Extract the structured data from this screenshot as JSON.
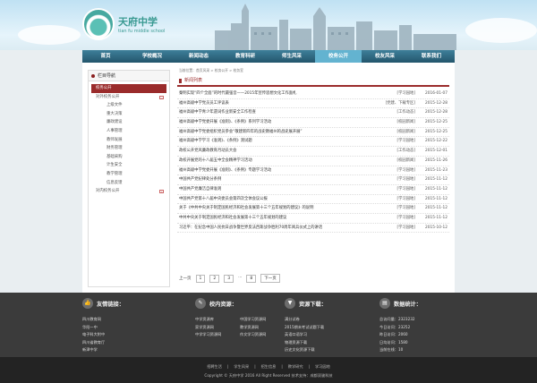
{
  "site": {
    "name_cn": "天府中学",
    "name_en": "tian fu middle school"
  },
  "nav": [
    "首页",
    "学校概况",
    "新闻动态",
    "教育科研",
    "师生风采",
    "校务公开",
    "校友风采",
    "联系我们"
  ],
  "nav_active_index": 5,
  "sidebar": {
    "title": "栏目导航",
    "items": [
      {
        "label": "校务公开",
        "level": "cat",
        "active": true
      },
      {
        "label": "对外校务公开",
        "level": "cat",
        "toggle": "−"
      },
      {
        "label": "上级文件",
        "level": "sub"
      },
      {
        "label": "重大决策",
        "level": "sub"
      },
      {
        "label": "廉政建设",
        "level": "sub"
      },
      {
        "label": "人事管理",
        "level": "sub"
      },
      {
        "label": "教师发展",
        "level": "sub"
      },
      {
        "label": "财务管理",
        "level": "sub"
      },
      {
        "label": "基础采购",
        "level": "sub"
      },
      {
        "label": "计生安全",
        "level": "sub"
      },
      {
        "label": "教学管理",
        "level": "sub"
      },
      {
        "label": "信息反馈",
        "level": "sub"
      },
      {
        "label": "对内校务公开",
        "level": "cat",
        "toggle": "+"
      }
    ]
  },
  "breadcrumb": "当前位置：首页风采 > 校务公开 > 校务室",
  "list_title": "新闻列表",
  "rows": [
    {
      "title": "秦明实现“四个全面”的时代最强音——2015年宣传思想文化工作面札",
      "category": "[学习园地]",
      "date": "2016-01-07"
    },
    {
      "title": "福州高级中学党员员工评议表",
      "category": "[党建、下载专区]",
      "date": "2015-12-28"
    },
    {
      "title": "福州高级中学青少年遗词作业新安全工作检查",
      "category": "[工作动态]",
      "date": "2015-12-28"
    },
    {
      "title": "福州高级中学党委开展《准则》、《条例》系列学习活动",
      "category": "[校园新闻]",
      "date": "2015-12-25"
    },
    {
      "title": "福州高级中学党委组织党员参会“敬建新四年的战史教福州的战史展开展”",
      "category": "[校园新闻]",
      "date": "2015-12-25"
    },
    {
      "title": "福州高级中学学习《准则》、《条例》测试题",
      "category": "[学习园地]",
      "date": "2015-12-22"
    },
    {
      "title": "政校公开党风廉政教育月动员大会",
      "category": "[工作动态]",
      "date": "2015-12-01"
    },
    {
      "title": "政校开展党的十八届五中全会精神学习活动",
      "category": "[校园新闻]",
      "date": "2015-11-26"
    },
    {
      "title": "福州高级中学党委开展《准则》、《条例》专题学习活动",
      "category": "[学习园地]",
      "date": "2015-11-23"
    },
    {
      "title": "中国共产党纪律处分条例",
      "category": "[学习园地]",
      "date": "2015-11-12"
    },
    {
      "title": "中国共产党廉洁自律准则",
      "category": "[学习园地]",
      "date": "2015-11-12"
    },
    {
      "title": "中国共产党第十八届中央委员会第四次全体会议公报",
      "category": "[学习园地]",
      "date": "2015-11-12"
    },
    {
      "title": "关于《中共中央关于制定国民经济和社会发展第十三个五年规划的建议》的说明",
      "category": "[学习园地]",
      "date": "2015-11-12"
    },
    {
      "title": "中共中央关于制定国民经济和社会发展第十三个五年规划的建议",
      "category": "[学习园地]",
      "date": "2015-11-12"
    },
    {
      "title": "习近平：在纪念中国人民抗日战争暨世界反法西斯战争胜利70周年阅兵仪式上的讲话",
      "category": "[学习园地]",
      "date": "2015-10-12"
    }
  ],
  "pager": {
    "prev": "上一页",
    "pages": [
      "1",
      "2",
      "3",
      "...",
      "8"
    ],
    "next": "下一页"
  },
  "footer": {
    "links": {
      "title": "友情链接：",
      "items": [
        "四川教育网",
        "华阳一中",
        "电子科大附中",
        "四川省教育厅",
        "新津中学"
      ]
    },
    "school": {
      "title": "校内资源：",
      "items": [
        "中学资源库",
        "中国学习资源网",
        "家学资源网",
        "教学资源网",
        "中学学习资源网",
        "作文学习资源网"
      ]
    },
    "download": {
      "title": "资源下载：",
      "items": [
        "满分试卷",
        "2015期末考试试题下载",
        "英语口语学习",
        "物理资源下载",
        "历史文化资源下载"
      ]
    },
    "stats": {
      "title": "数据统计：",
      "items": [
        "总访问量：2323232",
        "今日访问：23252",
        "昨日访问：2060",
        "日均访问：1580",
        "当前在线：10"
      ]
    }
  },
  "bottom": {
    "links": [
      "招聘生活",
      "学生风采",
      "招生信息",
      "教学研究",
      "学习园地"
    ],
    "copyright": "Copyright © 天府中学 2016 All Right Reserved 技术支持：成都双骏科技"
  },
  "colors": {
    "nav": "#2f6b85",
    "accent": "#9a2b2b",
    "footer": "#3b3b3b"
  },
  "icons": {
    "links": "thumbs-up-icon",
    "school": "chat-icon",
    "download": "download-icon",
    "stats": "chart-icon"
  }
}
